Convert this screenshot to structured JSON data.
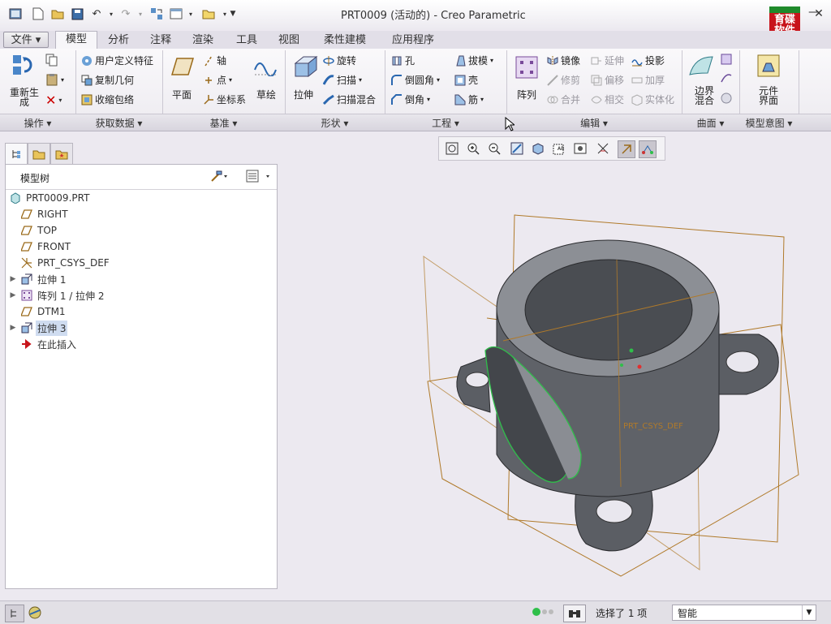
{
  "window": {
    "title": "PRT0009 (活动的) - Creo Parametric",
    "minimize_glyph": "—",
    "close_glyph": "✕",
    "help_glyph": "?"
  },
  "logo": {
    "line1": "育碟",
    "line2": "软件"
  },
  "tabs": [
    {
      "label": "文件 ▾"
    },
    {
      "label": "模型"
    },
    {
      "label": "分析"
    },
    {
      "label": "注释"
    },
    {
      "label": "渲染"
    },
    {
      "label": "工具"
    },
    {
      "label": "视图"
    },
    {
      "label": "柔性建模"
    },
    {
      "label": "应用程序"
    }
  ],
  "ribbon": {
    "operations": {
      "regenerate": "重新生成",
      "group": "操作"
    },
    "get_data": {
      "user_feature": "用户定义特征",
      "copy_geometry": "复制几何",
      "shrinkwrap": "收缩包络",
      "group": "获取数据"
    },
    "datum": {
      "plane": "平面",
      "axis": "轴",
      "point": "点",
      "csys": "坐标系",
      "sketch": "草绘",
      "group": "基准"
    },
    "shapes": {
      "extrude": "拉伸",
      "revolve": "旋转",
      "sweep": "扫描",
      "swept_blend": "扫描混合",
      "group": "形状"
    },
    "engineering": {
      "hole": "孔",
      "round": "倒圆角",
      "chamfer": "倒角",
      "draft": "拔模",
      "shell": "壳",
      "rib": "筋",
      "group": "工程"
    },
    "editing": {
      "pattern": "阵列",
      "mirror": "镜像",
      "trim": "修剪",
      "merge": "合并",
      "extend": "延伸",
      "offset": "偏移",
      "intersect": "相交",
      "project": "投影",
      "thicken": "加厚",
      "solidify": "实体化",
      "group": "编辑"
    },
    "surfaces": {
      "boundary_blend": "边界混合",
      "group": "曲面"
    },
    "model_intent": {
      "component_interface": "元件界面",
      "group": "模型意图"
    }
  },
  "model_tree": {
    "title": "模型树",
    "items": [
      {
        "label": "PRT0009.PRT",
        "icon": "part-icon"
      },
      {
        "label": "RIGHT",
        "icon": "datum-plane-icon"
      },
      {
        "label": "TOP",
        "icon": "datum-plane-icon"
      },
      {
        "label": "FRONT",
        "icon": "datum-plane-icon"
      },
      {
        "label": "PRT_CSYS_DEF",
        "icon": "csys-icon"
      },
      {
        "label": "拉伸 1",
        "icon": "extrude-icon"
      },
      {
        "label": "阵列 1 / 拉伸 2",
        "icon": "pattern-icon"
      },
      {
        "label": "DTM1",
        "icon": "datum-plane-icon"
      },
      {
        "label": "拉伸 3",
        "icon": "extrude-icon"
      },
      {
        "label": "在此插入",
        "icon": "insert-here-icon"
      }
    ]
  },
  "viewport": {
    "csys_label": "PRT_CSYS_DEF"
  },
  "status": {
    "selection": "选择了 1 项",
    "filter": "智能"
  },
  "colors": {
    "accent": "#cfdcf0",
    "model": "#5f6268",
    "datum": "#b07a2a",
    "highlight": "#2fbf4a"
  }
}
